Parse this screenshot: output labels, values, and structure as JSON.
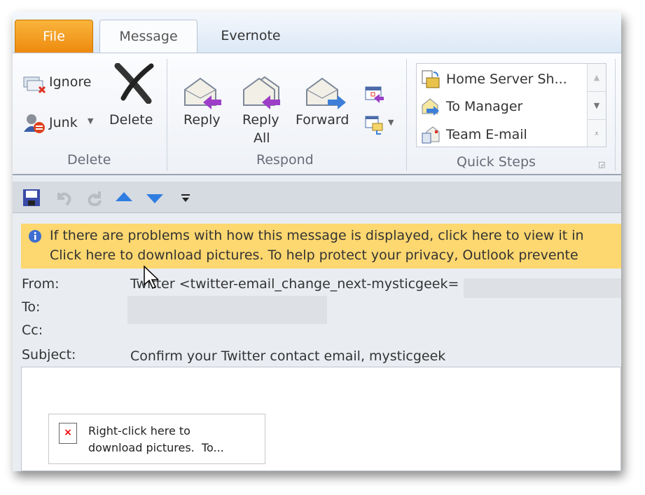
{
  "tabs": {
    "file": "File",
    "message": "Message",
    "evernote": "Evernote"
  },
  "ribbon": {
    "delete_group": {
      "ignore": "Ignore",
      "junk": "Junk",
      "delete": "Delete",
      "label": "Delete"
    },
    "respond_group": {
      "reply": "Reply",
      "reply_all_1": "Reply",
      "reply_all_2": "All",
      "forward": "Forward",
      "label": "Respond"
    },
    "quick_steps": {
      "items": [
        "Home Server Sh...",
        "To Manager",
        "Team E-mail"
      ],
      "label": "Quick Steps"
    }
  },
  "infobar": {
    "line1": "If there are problems with how this message is displayed, click here to view it in",
    "line2": "Click here to download pictures. To help protect your privacy, Outlook prevente"
  },
  "header": {
    "from_label": "From:",
    "from_value": "Twitter <twitter-email_change_next-mysticgeek=",
    "to_label": "To:",
    "cc_label": "Cc:",
    "subject_label": "Subject:",
    "subject_value": "Confirm your Twitter contact email, mysticgeek"
  },
  "body": {
    "placeholder_line1": "Right-click here to",
    "placeholder_line2": "download pictures.  To..."
  },
  "colors": {
    "file_tab": "#ee8a0f",
    "infobar": "#fdd76f"
  }
}
